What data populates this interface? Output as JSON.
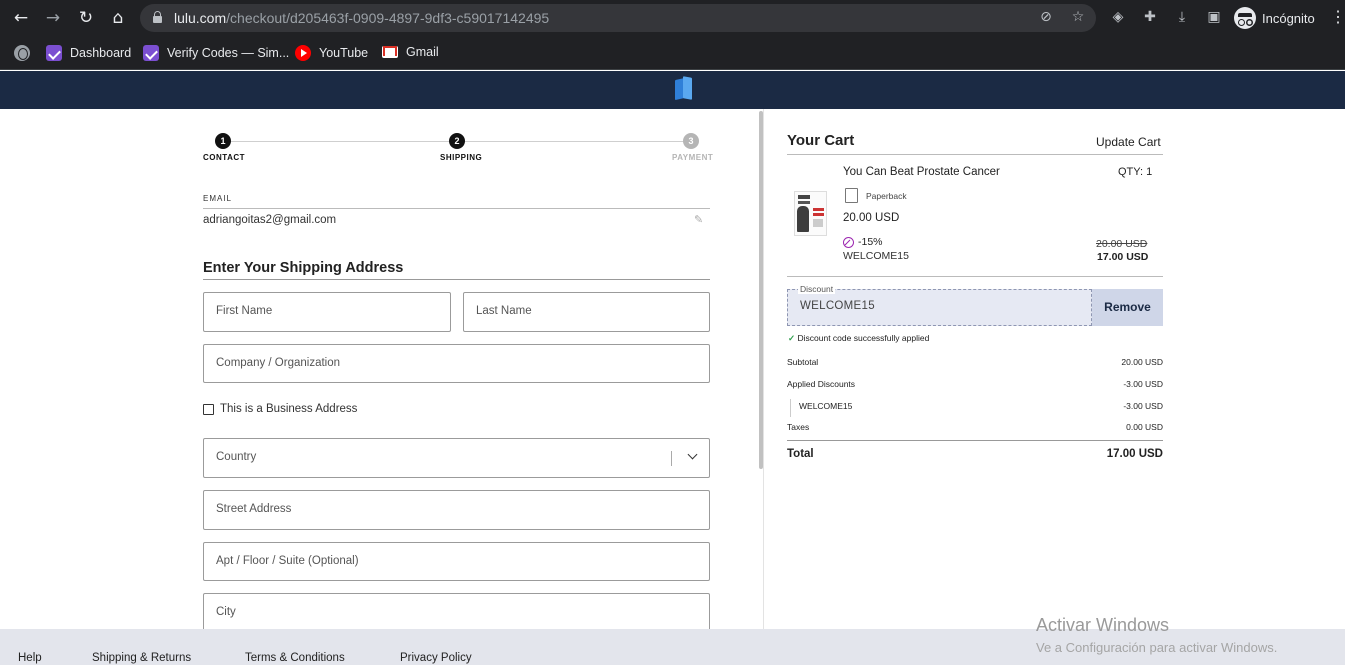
{
  "browser": {
    "url_host": "lulu.com",
    "url_path": "/checkout/d205463f-0909-4897-9df3-c59017142495",
    "profile_label": "Incógnito",
    "bookmarks": [
      {
        "label": "",
        "icon": "globe-icon"
      },
      {
        "label": "Dashboard",
        "icon": "purple-check-icon"
      },
      {
        "label": "Verify Codes — Sim...",
        "icon": "purple-check-icon"
      },
      {
        "label": "YouTube",
        "icon": "youtube-icon"
      },
      {
        "label": "Gmail",
        "icon": "gmail-icon"
      }
    ]
  },
  "site": {
    "brand_colors": {
      "header_bg": "#1b2a44",
      "logo": "#2f7fd8"
    }
  },
  "stepper": {
    "steps": [
      {
        "number": "1",
        "label": "CONTACT",
        "state": "complete"
      },
      {
        "number": "2",
        "label": "SHIPPING",
        "state": "current"
      },
      {
        "number": "3",
        "label": "PAYMENT",
        "state": "upcoming"
      }
    ]
  },
  "contact": {
    "email_label": "EMAIL",
    "email_value": "adriangoitas2@gmail.com"
  },
  "shipping": {
    "title": "Enter Your Shipping Address",
    "first_name_placeholder": "First Name",
    "last_name_placeholder": "Last Name",
    "company_placeholder": "Company / Organization",
    "business_checkbox_label": "This is a Business Address",
    "business_checked": false,
    "country_placeholder": "Country",
    "street_placeholder": "Street Address",
    "apt_placeholder": "Apt / Floor / Suite (Optional)",
    "city_placeholder": "City"
  },
  "cart": {
    "title": "Your Cart",
    "update_label": "Update Cart",
    "item": {
      "title": "You Can Beat Prostate Cancer",
      "qty": "QTY: 1",
      "format": "Paperback",
      "price": "20.00 USD",
      "discount_pct": "-15%",
      "discount_code": "WELCOME15",
      "old_price": "20.00 USD",
      "new_price": "17.00 USD"
    },
    "discount": {
      "label": "Discount",
      "value": "WELCOME15",
      "remove_label": "Remove",
      "success_check": "✓",
      "success_text": "Discount code successfully applied"
    },
    "summary": {
      "subtotal_label": "Subtotal",
      "subtotal_value": "20.00 USD",
      "applied_label": "Applied Discounts",
      "applied_value": "-3.00 USD",
      "code_label": "WELCOME15",
      "code_value": "-3.00 USD",
      "taxes_label": "Taxes",
      "taxes_value": "0.00 USD",
      "total_label": "Total",
      "total_value": "17.00 USD"
    }
  },
  "footer": {
    "links": [
      "Help",
      "Shipping & Returns",
      "Terms & Conditions",
      "Privacy Policy"
    ]
  },
  "watermark": {
    "title": "Activar Windows",
    "subtitle": "Ve a Configuración para activar Windows."
  }
}
